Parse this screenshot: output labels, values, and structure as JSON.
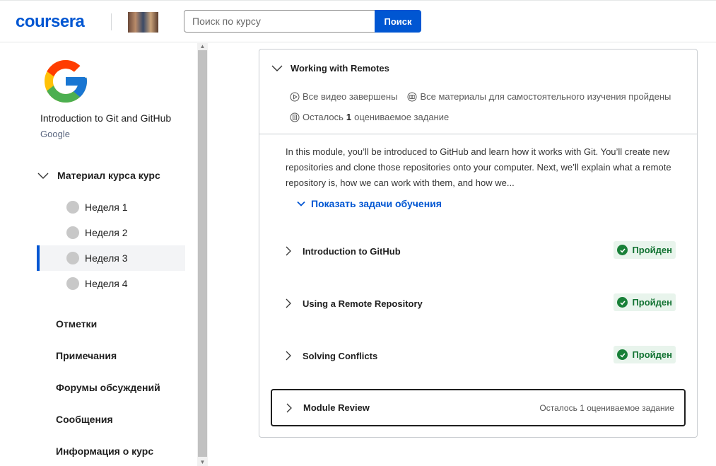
{
  "header": {
    "logo": "coursera",
    "search_placeholder": "Поиск по курсу",
    "search_button": "Поиск"
  },
  "sidebar": {
    "course_title": "Introduction to Git and GitHub",
    "partner": "Google",
    "section_label": "Материал курса курс",
    "weeks": [
      {
        "label": "Неделя 1",
        "active": false
      },
      {
        "label": "Неделя 2",
        "active": false
      },
      {
        "label": "Неделя 3",
        "active": true
      },
      {
        "label": "Неделя 4",
        "active": false
      }
    ],
    "nav": [
      "Отметки",
      "Примечания",
      "Форумы обсуждений",
      "Сообщения",
      "Информация о курс"
    ]
  },
  "module": {
    "title": "Working with Remotes",
    "videos_done": "Все видео завершены",
    "readings_done": "Все материалы для самостоятельного изучения пройдены",
    "remaining_prefix": "Осталось",
    "remaining_count": "1",
    "remaining_suffix": "оцениваемое задание",
    "description": "In this module, you’ll be introduced to GitHub and learn how it works with Git. You’ll create new repositories and clone those repositories onto your computer. Next, we’ll explain what a remote repository is, how we can work with them, and how we...",
    "show_tasks": "Показать задачи обучения",
    "lessons": [
      {
        "title": "Introduction to GitHub",
        "status": "Пройден"
      },
      {
        "title": "Using a Remote Repository",
        "status": "Пройден"
      },
      {
        "title": "Solving Conflicts",
        "status": "Пройден"
      }
    ],
    "review": {
      "title": "Module Review",
      "remaining": "Осталось 1 оцениваемое задание"
    }
  },
  "colors": {
    "brand": "#0056d2",
    "passed_bg": "#e8f4ec",
    "passed_text": "#137333"
  }
}
